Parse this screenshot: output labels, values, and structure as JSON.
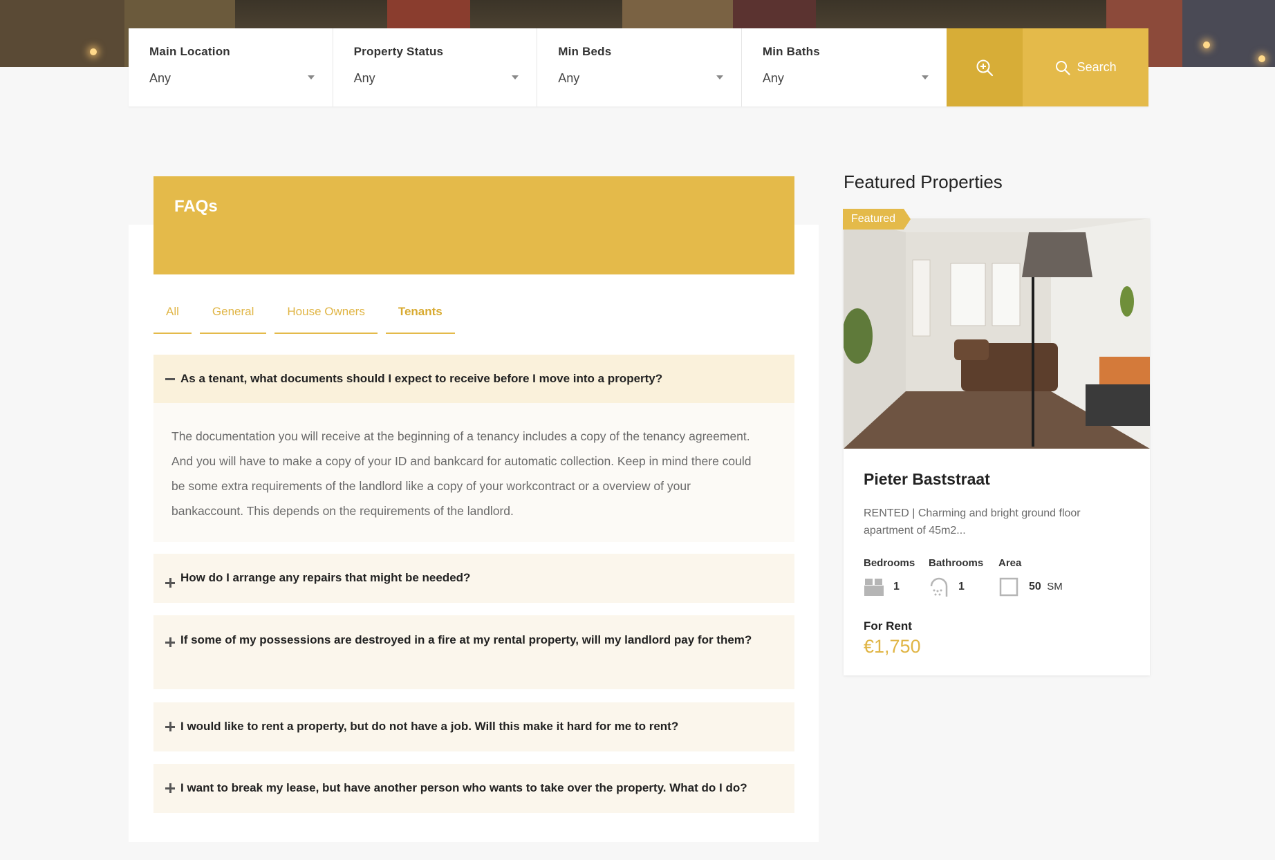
{
  "search": {
    "fields": [
      {
        "label": "Main Location",
        "value": "Any"
      },
      {
        "label": "Property Status",
        "value": "Any"
      },
      {
        "label": "Min Beds",
        "value": "Any"
      },
      {
        "label": "Min Baths",
        "value": "Any"
      }
    ],
    "advanced_icon": "zoom-in-icon",
    "button_label": "Search",
    "button_icon": "search-icon"
  },
  "faq": {
    "title": "FAQs",
    "tabs": [
      "All",
      "General",
      "House Owners",
      "Tenants"
    ],
    "active_tab": "Tenants",
    "questions": [
      {
        "q": "As a tenant, what documents should I expect to receive before I move into a property?",
        "expanded": true,
        "a": "The documentation you will receive at the beginning of a tenancy includes a copy of the tenancy agreement. And you will have to make a copy of your ID and bankcard for automatic collection. Keep in mind there could be some extra requirements of the landlord like a copy of your workcontract or a overview of your bankaccount. This depends on the requirements of the landlord."
      },
      {
        "q": "How do I arrange any repairs that might be needed?",
        "expanded": false
      },
      {
        "q": "If some of my possessions are destroyed in a fire at my rental property, will my landlord pay for them?",
        "expanded": false
      },
      {
        "q": "I would like to rent a property, but do not have a job. Will this make it hard for me to rent?",
        "expanded": false
      },
      {
        "q": "I want to break my lease, but have another person who wants to take over the property. What do I do?",
        "expanded": false
      }
    ]
  },
  "featured": {
    "heading": "Featured Properties",
    "badge": "Featured",
    "property": {
      "title": "Pieter Baststraat",
      "description": "RENTED | Charming and bright ground floor apartment of 45m2...",
      "bedrooms_label": "Bedrooms",
      "bedrooms": "1",
      "bathrooms_label": "Bathrooms",
      "bathrooms": "1",
      "area_label": "Area",
      "area": "50",
      "area_unit": "SM",
      "status_label": "For Rent",
      "price": "€1,750"
    }
  },
  "colors": {
    "accent": "#e4ba4a",
    "accent_dark": "#d7ad37",
    "faq_bg": "#fbf6ec"
  }
}
